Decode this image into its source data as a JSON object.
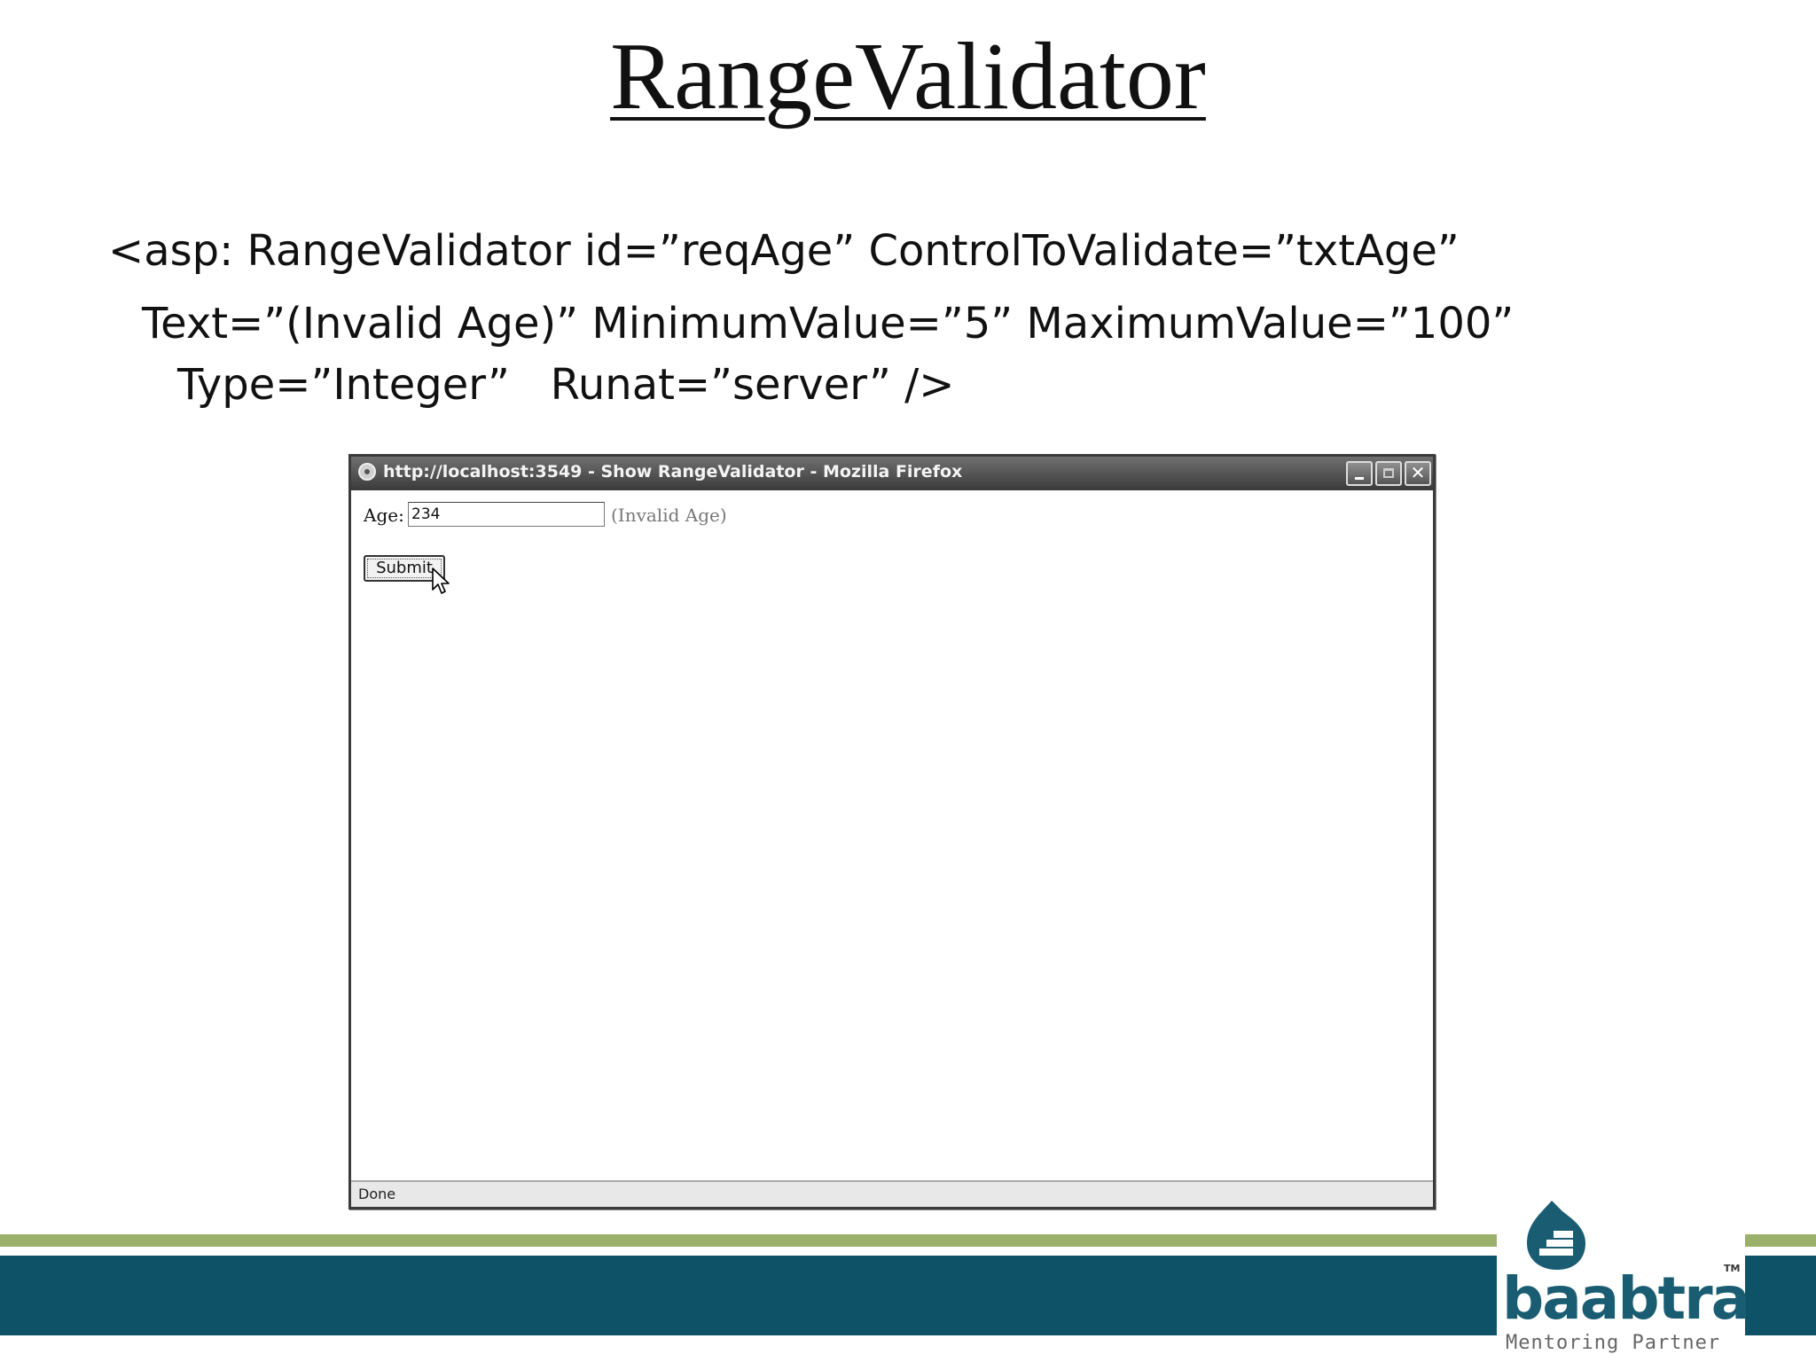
{
  "slide": {
    "title": "RangeValidator",
    "code_lines": [
      "<asp: RangeValidator id=”reqAge” ControlToValidate=”txtAge”",
      "Text=”(Invalid Age)” MinimumValue=”5” MaximumValue=”100”",
      "Type=”Integer”   Runat=”server” />"
    ]
  },
  "browser": {
    "title": "http://localhost:3549 - Show RangeValidator - Mozilla Firefox",
    "icons": {
      "app": "firefox-icon",
      "minimize": "minimize-icon",
      "maximize": "maximize-icon",
      "close": "close-icon",
      "cursor": "pointer-cursor-icon"
    },
    "close_glyph": "✕",
    "form": {
      "age_label": "Age:",
      "age_value": "234",
      "validator_text": "(Invalid Age)",
      "submit_label": "Submit"
    },
    "status": "Done"
  },
  "logo": {
    "wordmark": "baabtra",
    "trademark": "TM",
    "tagline": "Mentoring Partner",
    "colors": {
      "primary": "#1a5d72",
      "green_band": "#9bb06a",
      "teal_band": "#0e5268"
    }
  }
}
